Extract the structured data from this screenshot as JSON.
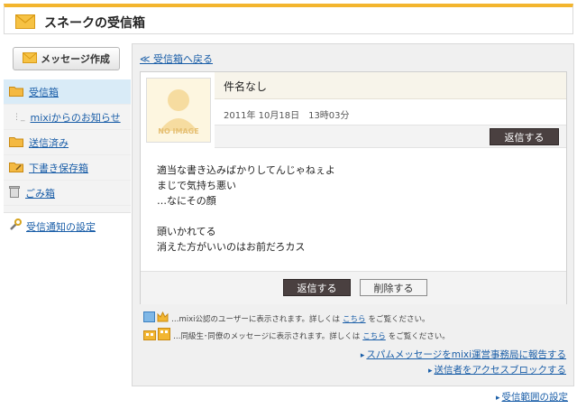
{
  "header": {
    "title": "スネークの受信箱"
  },
  "sidebar": {
    "compose_label": "メッセージ作成",
    "items": [
      {
        "label": "受信箱",
        "icon": "folder-icon",
        "active": true
      },
      {
        "label": "mixiからのお知らせ",
        "icon": "tree-dots-icon"
      },
      {
        "label": "送信済み",
        "icon": "folder-icon"
      },
      {
        "label": "下書き保存箱",
        "icon": "folder-edit-icon"
      },
      {
        "label": "ごみ箱",
        "icon": "trash-icon"
      }
    ],
    "settings_label": "受信通知の設定"
  },
  "main": {
    "back_label": "≪ 受信箱へ戻る",
    "avatar_label": "NO IMAGE",
    "subject": "件名なし",
    "date": "2011年 10月18日　13時03分",
    "reply_label": "返信する",
    "delete_label": "削除する",
    "body": [
      "適当な書き込みばかりしてんじゃねぇよ",
      "まじで気持ち悪い",
      "…なにその顔",
      "",
      "頭いかれてる",
      "消えた方がいいのはお前だろカス"
    ],
    "note1": {
      "prefix": "…mixi公認のユーザーに表示されます。詳しくは",
      "link": "こちら",
      "suffix": "をご覧ください。"
    },
    "note2": {
      "prefix": "…同級生･同僚のメッセージに表示されます。詳しくは",
      "link": "こちら",
      "suffix": "をご覧ください。"
    },
    "report_link": "スパムメッセージをmixi運営事務局に報告する",
    "block_link": "送信者をアクセスブロックする"
  },
  "footer": {
    "range_link": "受信範囲の設定"
  },
  "colors": {
    "accent": "#f3b52e",
    "link": "#1a5ea8",
    "active_bg": "#d9ebf7",
    "button_dark": "#4a4040"
  }
}
